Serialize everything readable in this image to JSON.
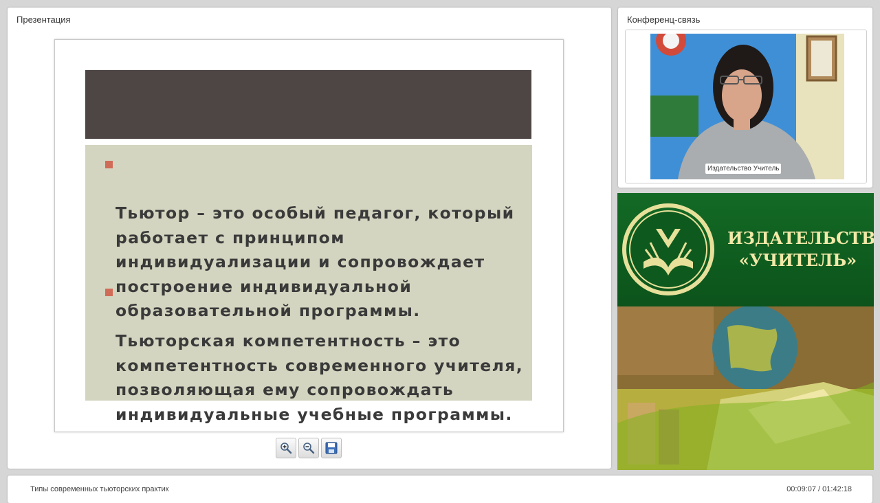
{
  "presentation": {
    "title": "Презентация",
    "slide": {
      "bullets": [
        "Тьютор – это особый педагог, который\nработает с принципом\nиндивидуализации и сопровождает\nпостроение индивидуальной\nобразовательной программы.",
        "Тьюторская компетентность – это\nкомпетентность современного учителя,\nпозволяющая ему сопровождать\nиндивидуальные учебные программы."
      ]
    },
    "toolbar": {
      "zoom_in_icon": "zoom-in-icon",
      "zoom_out_icon": "zoom-out-icon",
      "save_icon": "save-icon"
    }
  },
  "conference": {
    "title": "Конференц-связь",
    "video_label": "Издательство Учитель"
  },
  "brand": {
    "name": "ИЗДАТЕЛЬСТВО\n«УЧИТЕЛЬ»",
    "colors": {
      "green": "#136a25",
      "gold": "#f2e9a8"
    }
  },
  "footer": {
    "lecture_title": "Типы современных тьюторских практик",
    "timecode": "00:09:07 / 01:42:18"
  }
}
